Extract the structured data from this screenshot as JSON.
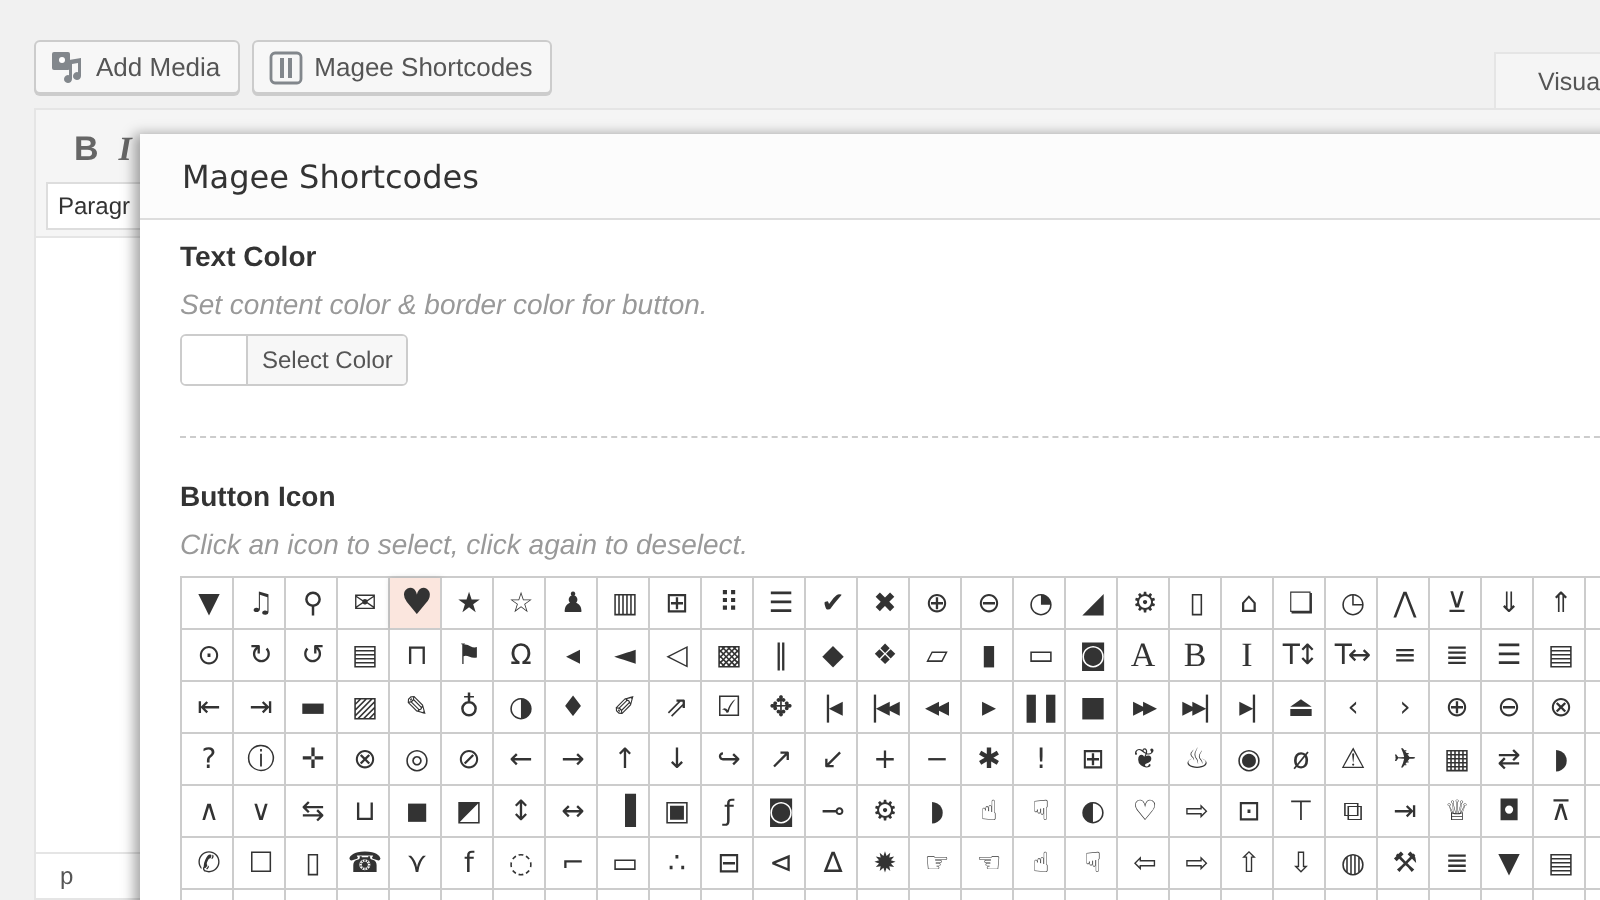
{
  "top_buttons": [
    {
      "kind": "media",
      "label": "Add Media"
    },
    {
      "kind": "shortcodes",
      "label": "Magee Shortcodes"
    }
  ],
  "editor_tabs": [
    {
      "label": "Visua",
      "selected": true
    }
  ],
  "toolbar": {
    "buttons": [
      {
        "label": "B",
        "kind": "bold"
      },
      {
        "label": "I",
        "kind": "italic"
      }
    ],
    "format_select": "Paragr"
  },
  "status_path": "p",
  "modal": {
    "title": "Magee Shortcodes",
    "sections": [
      {
        "kind": "color",
        "label": "Text Color",
        "hint": "Set content color & border color for button.",
        "button": "Select Color"
      },
      {
        "kind": "icons",
        "label": "Button Icon",
        "hint": "Click an icon to select, click again to deselect.",
        "icon_rows": [
          [
            {
              "glyph": "▼",
              "selected": false
            },
            {
              "glyph": "♫",
              "selected": false
            },
            {
              "glyph": "⚲",
              "selected": false
            },
            {
              "glyph": "✉",
              "selected": false
            },
            {
              "glyph": "♥",
              "selected": true
            },
            {
              "glyph": "★",
              "selected": false
            },
            {
              "glyph": "☆",
              "selected": false
            },
            {
              "glyph": "♟",
              "selected": false
            },
            {
              "glyph": "▥",
              "selected": false
            },
            {
              "glyph": "⊞",
              "selected": false
            },
            {
              "glyph": "⠿",
              "selected": false
            },
            {
              "glyph": "☰",
              "selected": false
            },
            {
              "glyph": "✔",
              "selected": false
            },
            {
              "glyph": "✖",
              "selected": false
            },
            {
              "glyph": "⊕",
              "selected": false
            },
            {
              "glyph": "⊖",
              "selected": false
            },
            {
              "glyph": "◔",
              "selected": false
            },
            {
              "glyph": "◢",
              "selected": false
            },
            {
              "glyph": "⚙",
              "selected": false
            },
            {
              "glyph": "▯",
              "selected": false
            },
            {
              "glyph": "⌂",
              "selected": false
            },
            {
              "glyph": "❏",
              "selected": false
            },
            {
              "glyph": "◷",
              "selected": false
            },
            {
              "glyph": "⋀",
              "selected": false
            },
            {
              "glyph": "⊻",
              "selected": false
            },
            {
              "glyph": "⇓",
              "selected": false
            },
            {
              "glyph": "⇑",
              "selected": false
            }
          ],
          [
            {
              "glyph": "⊙",
              "selected": false
            },
            {
              "glyph": "↻",
              "selected": false
            },
            {
              "glyph": "↺",
              "selected": false
            },
            {
              "glyph": "▤",
              "selected": false
            },
            {
              "glyph": "⊓",
              "selected": false
            },
            {
              "glyph": "⚑",
              "selected": false
            },
            {
              "glyph": "Ω",
              "selected": false
            },
            {
              "glyph": "◂",
              "selected": false
            },
            {
              "glyph": "◄",
              "selected": false
            },
            {
              "glyph": "◁",
              "selected": false
            },
            {
              "glyph": "▩",
              "selected": false
            },
            {
              "glyph": "‖",
              "selected": false
            },
            {
              "glyph": "◆",
              "selected": false
            },
            {
              "glyph": "❖",
              "selected": false
            },
            {
              "glyph": "▱",
              "selected": false
            },
            {
              "glyph": "▮",
              "selected": false
            },
            {
              "glyph": "▭",
              "selected": false
            },
            {
              "glyph": "◙",
              "selected": false
            },
            {
              "glyph": "A",
              "selected": false
            },
            {
              "glyph": "B",
              "selected": false
            },
            {
              "glyph": "I",
              "selected": false
            },
            {
              "glyph": "T↕",
              "selected": false
            },
            {
              "glyph": "T↔",
              "selected": false
            },
            {
              "glyph": "≡",
              "selected": false
            },
            {
              "glyph": "≣",
              "selected": false
            },
            {
              "glyph": "☰",
              "selected": false
            },
            {
              "glyph": "▤",
              "selected": false
            }
          ],
          [
            {
              "glyph": "⇤",
              "selected": false
            },
            {
              "glyph": "⇥",
              "selected": false
            },
            {
              "glyph": "▬",
              "selected": false
            },
            {
              "glyph": "▨",
              "selected": false
            },
            {
              "glyph": "✎",
              "selected": false
            },
            {
              "glyph": "♁",
              "selected": false
            },
            {
              "glyph": "◑",
              "selected": false
            },
            {
              "glyph": "♦",
              "selected": false
            },
            {
              "glyph": "✐",
              "selected": false
            },
            {
              "glyph": "⇗",
              "selected": false
            },
            {
              "glyph": "☑",
              "selected": false
            },
            {
              "glyph": "✥",
              "selected": false
            },
            {
              "glyph": "|◂",
              "selected": false
            },
            {
              "glyph": "|◂◂",
              "selected": false
            },
            {
              "glyph": "◂◂",
              "selected": false
            },
            {
              "glyph": "▸",
              "selected": false
            },
            {
              "glyph": "❚❚",
              "selected": false
            },
            {
              "glyph": "■",
              "selected": false
            },
            {
              "glyph": "▸▸",
              "selected": false
            },
            {
              "glyph": "▸▸|",
              "selected": false
            },
            {
              "glyph": "▸|",
              "selected": false
            },
            {
              "glyph": "⏏",
              "selected": false
            },
            {
              "glyph": "‹",
              "selected": false
            },
            {
              "glyph": "›",
              "selected": false
            },
            {
              "glyph": "⊕",
              "selected": false
            },
            {
              "glyph": "⊖",
              "selected": false
            },
            {
              "glyph": "⊗",
              "selected": false
            }
          ],
          [
            {
              "glyph": "?",
              "selected": false
            },
            {
              "glyph": "ⓘ",
              "selected": false
            },
            {
              "glyph": "✛",
              "selected": false
            },
            {
              "glyph": "⊗",
              "selected": false
            },
            {
              "glyph": "◎",
              "selected": false
            },
            {
              "glyph": "⊘",
              "selected": false
            },
            {
              "glyph": "←",
              "selected": false
            },
            {
              "glyph": "→",
              "selected": false
            },
            {
              "glyph": "↑",
              "selected": false
            },
            {
              "glyph": "↓",
              "selected": false
            },
            {
              "glyph": "↪",
              "selected": false
            },
            {
              "glyph": "↗",
              "selected": false
            },
            {
              "glyph": "↙",
              "selected": false
            },
            {
              "glyph": "+",
              "selected": false
            },
            {
              "glyph": "−",
              "selected": false
            },
            {
              "glyph": "✱",
              "selected": false
            },
            {
              "glyph": "!",
              "selected": false
            },
            {
              "glyph": "⊞",
              "selected": false
            },
            {
              "glyph": "❦",
              "selected": false
            },
            {
              "glyph": "♨",
              "selected": false
            },
            {
              "glyph": "◉",
              "selected": false
            },
            {
              "glyph": "ø",
              "selected": false
            },
            {
              "glyph": "⚠",
              "selected": false
            },
            {
              "glyph": "✈",
              "selected": false
            },
            {
              "glyph": "▦",
              "selected": false
            },
            {
              "glyph": "⇄",
              "selected": false
            },
            {
              "glyph": "◗",
              "selected": false
            }
          ],
          [
            {
              "glyph": "∧",
              "selected": false
            },
            {
              "glyph": "∨",
              "selected": false
            },
            {
              "glyph": "⇆",
              "selected": false
            },
            {
              "glyph": "⊔",
              "selected": false
            },
            {
              "glyph": "◼",
              "selected": false
            },
            {
              "glyph": "◩",
              "selected": false
            },
            {
              "glyph": "↕",
              "selected": false
            },
            {
              "glyph": "↔",
              "selected": false
            },
            {
              "glyph": "▐",
              "selected": false
            },
            {
              "glyph": "▣",
              "selected": false
            },
            {
              "glyph": "ƒ",
              "selected": false
            },
            {
              "glyph": "◙",
              "selected": false
            },
            {
              "glyph": "⊸",
              "selected": false
            },
            {
              "glyph": "⚙",
              "selected": false
            },
            {
              "glyph": "◗",
              "selected": false
            },
            {
              "glyph": "☝",
              "selected": false
            },
            {
              "glyph": "☟",
              "selected": false
            },
            {
              "glyph": "◐",
              "selected": false
            },
            {
              "glyph": "♡",
              "selected": false
            },
            {
              "glyph": "⇨",
              "selected": false
            },
            {
              "glyph": "⊡",
              "selected": false
            },
            {
              "glyph": "⊤",
              "selected": false
            },
            {
              "glyph": "⧉",
              "selected": false
            },
            {
              "glyph": "⇥",
              "selected": false
            },
            {
              "glyph": "♕",
              "selected": false
            },
            {
              "glyph": "◘",
              "selected": false
            },
            {
              "glyph": "⊼",
              "selected": false
            }
          ],
          [
            {
              "glyph": "✆",
              "selected": false
            },
            {
              "glyph": "☐",
              "selected": false
            },
            {
              "glyph": "▯",
              "selected": false
            },
            {
              "glyph": "☎",
              "selected": false
            },
            {
              "glyph": "⋎",
              "selected": false
            },
            {
              "glyph": "f",
              "selected": false
            },
            {
              "glyph": "◌",
              "selected": false
            },
            {
              "glyph": "⌐",
              "selected": false
            },
            {
              "glyph": "▭",
              "selected": false
            },
            {
              "glyph": "∴",
              "selected": false
            },
            {
              "glyph": "⊟",
              "selected": false
            },
            {
              "glyph": "⊲",
              "selected": false
            },
            {
              "glyph": "∆",
              "selected": false
            },
            {
              "glyph": "✹",
              "selected": false
            },
            {
              "glyph": "☞",
              "selected": false
            },
            {
              "glyph": "☜",
              "selected": false
            },
            {
              "glyph": "☝",
              "selected": false
            },
            {
              "glyph": "☟",
              "selected": false
            },
            {
              "glyph": "⇦",
              "selected": false
            },
            {
              "glyph": "⇨",
              "selected": false
            },
            {
              "glyph": "⇧",
              "selected": false
            },
            {
              "glyph": "⇩",
              "selected": false
            },
            {
              "glyph": "◍",
              "selected": false
            },
            {
              "glyph": "⚒",
              "selected": false
            },
            {
              "glyph": "≣",
              "selected": false
            },
            {
              "glyph": "▼",
              "selected": false
            },
            {
              "glyph": "▤",
              "selected": false
            }
          ]
        ]
      }
    ]
  }
}
